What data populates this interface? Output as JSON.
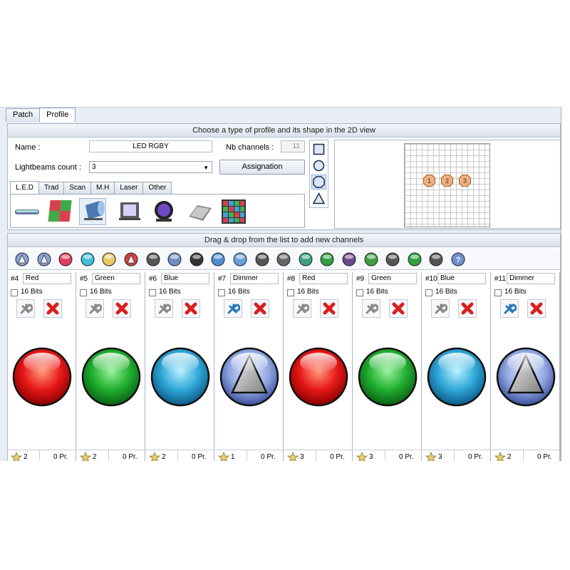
{
  "tabs": [
    "Patch",
    "Profile"
  ],
  "active_tab": "Profile",
  "profile": {
    "header": "Choose a type of profile and its shape in the 2D view",
    "name_label": "Name :",
    "name_value": "LED RGBY",
    "nb_channels_label": "Nb channels :",
    "nb_channels_value": "11",
    "lightbeams_label": "Lightbeams count :",
    "lightbeams_value": "3",
    "assignation_button": "Assignation",
    "fixture_tabs": [
      "L.E.D",
      "Trad",
      "Scan",
      "M.H",
      "Laser",
      "Other"
    ],
    "active_fixture_tab": "L.E.D",
    "fixture_icons": [
      "led-bar-icon",
      "led-panel-icon",
      "par-can-icon",
      "flood-light-icon",
      "led-par-icon",
      "matrix-tile-icon",
      "pixel-matrix-icon"
    ],
    "shapes": [
      "square-shape-icon",
      "circle-shape-icon",
      "octagon-shape-icon",
      "triangle-shape-icon"
    ],
    "selected_shape": "octagon-shape-icon",
    "beams": [
      "1",
      "2",
      "3"
    ]
  },
  "channels_panel": {
    "header": "Drag & drop from the list to add new channels",
    "toolbar_icons": [
      "dimmer-icon",
      "shutter-icon",
      "rgb-color-icon",
      "cmy-color-icon",
      "amber-icon",
      "color-wheel-icon",
      "gobo-icon",
      "gobo-rotation-icon",
      "iris-icon",
      "prism-icon",
      "zoom-icon",
      "focus-icon",
      "frost-icon",
      "pan-icon",
      "tilt-icon",
      "speed-icon",
      "effect-icon",
      "macro-icon",
      "reset-icon",
      "lamp-icon",
      "help-icon"
    ],
    "channels": [
      {
        "number": "#4",
        "name": "Red",
        "bits": "16 Bits",
        "type": "red",
        "count": "2",
        "presets": "0 Pr."
      },
      {
        "number": "#5",
        "name": "Green",
        "bits": "16 Bits",
        "type": "green",
        "count": "2",
        "presets": "0 Pr."
      },
      {
        "number": "#6",
        "name": "Blue",
        "bits": "16 Bits",
        "type": "blue",
        "count": "2",
        "presets": "0 Pr."
      },
      {
        "number": "#7",
        "name": "Dimmer",
        "bits": "16 Bits",
        "type": "dimmer",
        "count": "1",
        "presets": "0 Pr."
      },
      {
        "number": "#8",
        "name": "Red",
        "bits": "16 Bits",
        "type": "red",
        "count": "3",
        "presets": "0 Pr."
      },
      {
        "number": "#9",
        "name": "Green",
        "bits": "16 Bits",
        "type": "green",
        "count": "3",
        "presets": "0 Pr."
      },
      {
        "number": "#10",
        "name": "Blue",
        "bits": "16 Bits",
        "type": "blue",
        "count": "3",
        "presets": "0 Pr."
      },
      {
        "number": "#11",
        "name": "Dimmer",
        "bits": "16 Bits",
        "type": "dimmer",
        "count": "2",
        "presets": "0 Pr."
      }
    ]
  },
  "colors": {
    "red": "#e01010",
    "green": "#18a830",
    "blue": "#30a8d8",
    "dimmer": "#6a80c8",
    "beam": "#f0b080",
    "delete": "#d82020"
  }
}
